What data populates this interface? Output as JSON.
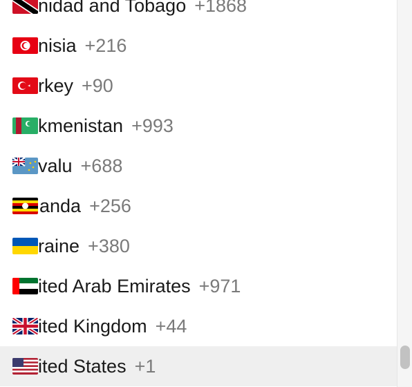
{
  "countries": [
    {
      "name": "nidad and Tobago",
      "code": "+1868",
      "flag": "trinidad-flag-icon"
    },
    {
      "name": "nisia",
      "code": "+216",
      "flag": "tunisia-flag-icon"
    },
    {
      "name": "rkey",
      "code": "+90",
      "flag": "turkey-flag-icon"
    },
    {
      "name": "kmenistan",
      "code": "+993",
      "flag": "turkmenistan-flag-icon"
    },
    {
      "name": "valu",
      "code": "+688",
      "flag": "tuvalu-flag-icon"
    },
    {
      "name": "anda",
      "code": "+256",
      "flag": "uganda-flag-icon"
    },
    {
      "name": "raine",
      "code": "+380",
      "flag": "ukraine-flag-icon"
    },
    {
      "name": "ited Arab Emirates",
      "code": "+971",
      "flag": "uae-flag-icon"
    },
    {
      "name": "ited Kingdom",
      "code": "+44",
      "flag": "uk-flag-icon"
    },
    {
      "name": "ited States",
      "code": "+1",
      "flag": "us-flag-icon"
    }
  ],
  "colors": {
    "selected_row_bg": "#efefef",
    "code_text": "#7a7a7a",
    "scrollbar_thumb": "#c2c2c2"
  }
}
